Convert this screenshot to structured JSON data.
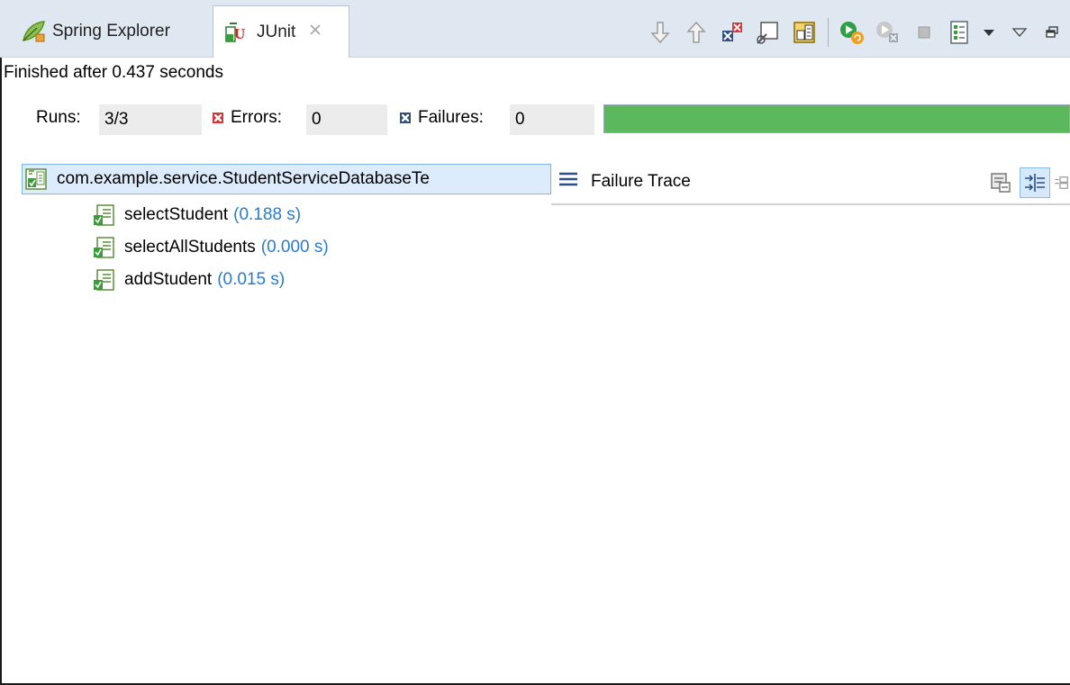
{
  "tabs": [
    {
      "label": "Spring Explorer",
      "icon": "spring-leaf-icon",
      "active": false
    },
    {
      "label": "JUnit",
      "icon": "junit-icon",
      "active": true,
      "close_icon": "close-icon"
    }
  ],
  "toolbar": {
    "buttons": [
      "next-failure-icon",
      "previous-failure-icon",
      "show-failures-only-icon",
      "scroll-lock-icon",
      "show-skipped-icon",
      "rerun-test-icon",
      "rerun-failed-first-icon",
      "stop-icon",
      "test-run-history-icon",
      "history-dropdown-icon",
      "view-menu-icon",
      "minimize-icon"
    ]
  },
  "status": {
    "finished": "Finished after 0.437 seconds"
  },
  "counters": {
    "runs_label": "Runs:",
    "runs_value": "3/3",
    "errors_label": "Errors:",
    "errors_value": "0",
    "failures_label": "Failures:",
    "failures_value": "0",
    "progress_fraction": 1.0,
    "progress_color": "#5cb85c"
  },
  "tree": {
    "root": {
      "label": "com.example.service.StudentServiceDatabaseTe",
      "icon": "test-suite-icon"
    },
    "children": [
      {
        "name": "selectStudent",
        "duration": "(0.188 s)",
        "icon": "test-passed-icon"
      },
      {
        "name": "selectAllStudents",
        "duration": "(0.000 s)",
        "icon": "test-passed-icon"
      },
      {
        "name": "addStudent",
        "duration": "(0.015 s)",
        "icon": "test-passed-icon"
      }
    ]
  },
  "failure_trace": {
    "title": "Failure Trace",
    "tools": [
      "compare-results-icon",
      "filter-stack-trace-icon",
      "copy-trace-icon"
    ]
  },
  "colors": {
    "accent": "#2a7bd0",
    "tabbar": "#dfe7f1",
    "selection": "#dcecfc",
    "error": "#d9343a",
    "failure": "#33507d"
  }
}
